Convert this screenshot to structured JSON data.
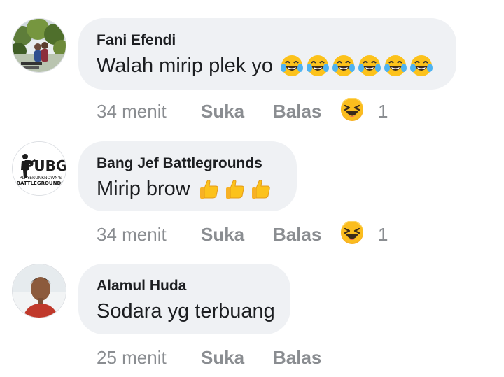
{
  "comments": [
    {
      "author": "Fani Efendi",
      "text": "Walah mirip plek yo",
      "emoji": "tears-of-joy-emoji",
      "emoji_count": 6,
      "time": "34 menit",
      "like_label": "Suka",
      "reply_label": "Balas",
      "reaction_icon": "laughing-reaction-icon",
      "reaction_count": "1"
    },
    {
      "author": "Bang Jef Battlegrounds",
      "text": "Mirip brow",
      "emoji": "thumbs-up-emoji",
      "emoji_count": 3,
      "time": "34 menit",
      "like_label": "Suka",
      "reply_label": "Balas",
      "reaction_icon": "laughing-reaction-icon",
      "reaction_count": "1",
      "avatar_logo_text": "PUBG",
      "avatar_logo_subtext": [
        "PLAYERUNKNOWN'S",
        "BATTLEGROUNDS"
      ]
    },
    {
      "author": "Alamul Huda",
      "text": "Sodara yg terbuang",
      "time": "25 menit",
      "like_label": "Suka",
      "reply_label": "Balas"
    }
  ],
  "colors": {
    "bubble": "#eff1f4",
    "text": "#1c1e21",
    "meta": "#8a8d91",
    "emoji_yellow": "#fcc21b"
  }
}
